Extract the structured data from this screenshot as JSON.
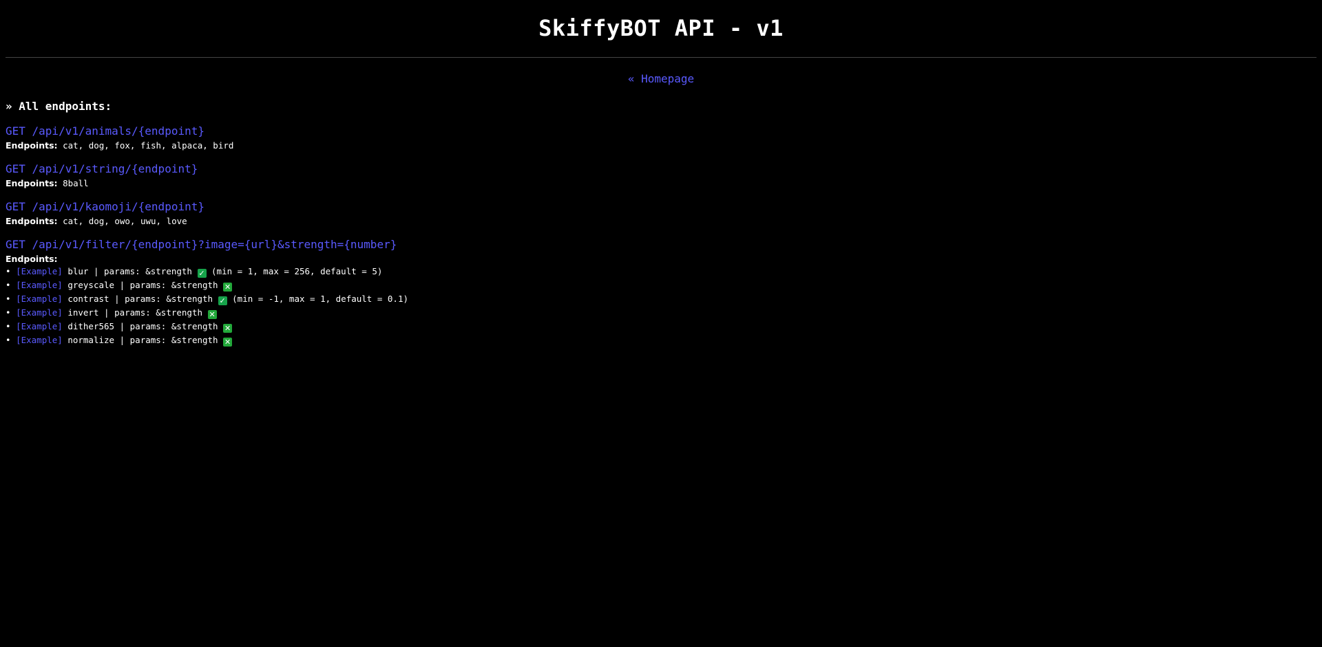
{
  "title": "SkiffyBOT API - v1",
  "nav": {
    "homepage_label": "« Homepage"
  },
  "section_title": "» All endpoints:",
  "endpoints_label": "Endpoints:",
  "groups": [
    {
      "route": "GET /api/v1/animals/{endpoint}",
      "endpoints": "cat, dog, fox, fish, alpaca, bird"
    },
    {
      "route": "GET /api/v1/string/{endpoint}",
      "endpoints": "8ball"
    },
    {
      "route": "GET /api/v1/kaomoji/{endpoint}",
      "endpoints": "cat, dog, owo, uwu, love"
    }
  ],
  "filter": {
    "route": "GET /api/v1/filter/{endpoint}?image={url}&strength={number}",
    "bullet": "•",
    "example_label": "[Example]",
    "items": [
      {
        "name": "blur",
        "params": "| params: &strength",
        "supported": "✓",
        "range": "(min = 1, max = 256, default = 5)"
      },
      {
        "name": "greyscale",
        "params": "| params: &strength",
        "supported": "✕",
        "range": ""
      },
      {
        "name": "contrast",
        "params": "| params: &strength",
        "supported": "✓",
        "range": "(min = -1, max = 1, default = 0.1)"
      },
      {
        "name": "invert",
        "params": "| params: &strength",
        "supported": "✕",
        "range": ""
      },
      {
        "name": "dither565",
        "params": "| params: &strength",
        "supported": "✕",
        "range": ""
      },
      {
        "name": "normalize",
        "params": "| params: &strength",
        "supported": "✕",
        "range": ""
      }
    ]
  },
  "colors": {
    "background": "#000000",
    "link": "#5a5aff",
    "badge": "#16a34a"
  }
}
